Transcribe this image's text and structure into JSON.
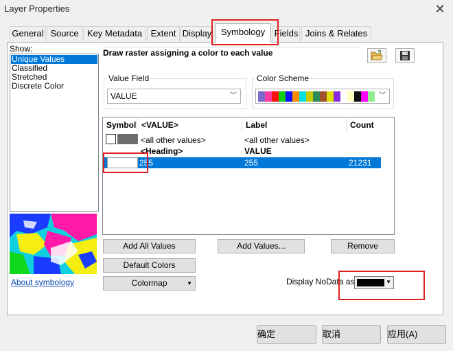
{
  "window": {
    "title": "Layer Properties",
    "close_glyph": "✕"
  },
  "tabs": [
    {
      "label": "General"
    },
    {
      "label": "Source"
    },
    {
      "label": "Key Metadata"
    },
    {
      "label": "Extent"
    },
    {
      "label": "Display"
    },
    {
      "label": "Symbology"
    },
    {
      "label": "Fields"
    },
    {
      "label": "Joins & Relates"
    }
  ],
  "show": {
    "label": "Show:",
    "items": [
      "Unique Values",
      "Classified",
      "Stretched",
      "Discrete Color"
    ],
    "selected": "Unique Values"
  },
  "about_link": "About symbology",
  "description": "Draw raster assigning a color to each value",
  "value_field": {
    "label": "Value Field",
    "value": "VALUE"
  },
  "color_scheme": {
    "label": "Color Scheme",
    "colors": [
      "#7b68c8",
      "#ff3aa0",
      "#ff1010",
      "#10d010",
      "#1010ff",
      "#ff8c00",
      "#00e0e0",
      "#c8c800",
      "#2e8b57",
      "#a0522d",
      "#e0e000",
      "#8a2be2",
      "#ffffff",
      "#ffffc0",
      "#101010",
      "#ff00ff",
      "#90ee90"
    ]
  },
  "table": {
    "columns": [
      "Symbol",
      "<VALUE>",
      "Label",
      "Count"
    ],
    "rows": [
      {
        "value": "<all other values>",
        "label": "<all other values>",
        "count": ""
      },
      {
        "value": "<Heading>",
        "label": "VALUE",
        "count": ""
      },
      {
        "value": "255",
        "label": "255",
        "count": "21231"
      }
    ]
  },
  "buttons": {
    "add_all": "Add All Values",
    "add_values": "Add Values...",
    "remove": "Remove",
    "default_colors": "Default Colors",
    "colormap": "Colormap"
  },
  "nodata": {
    "label": "Display NoData as",
    "color": "#000000"
  },
  "footer": {
    "ok": "确定",
    "cancel": "取消",
    "apply": "应用(A)"
  },
  "accent": "#0078d7",
  "highlight": "#e02020"
}
